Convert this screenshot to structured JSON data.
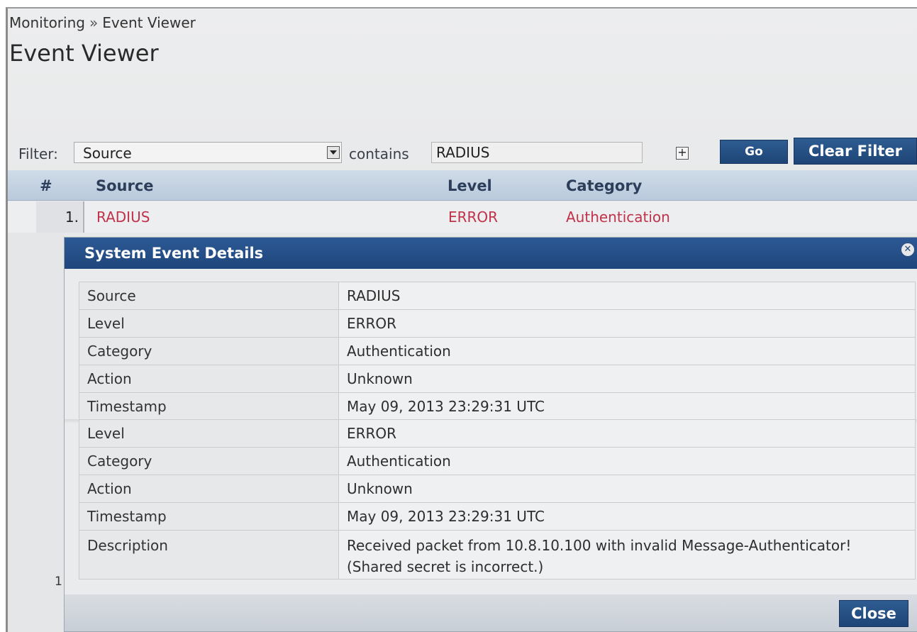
{
  "breadcrumb": {
    "parent": "Monitoring",
    "separator": "»",
    "current": "Event Viewer"
  },
  "page_title": "Event Viewer",
  "filter": {
    "label": "Filter:",
    "field_selected": "Source",
    "operator_label": "contains",
    "value": "RADIUS",
    "add_icon": "+",
    "go_label": "Go",
    "clear_label": "Clear Filter"
  },
  "grid": {
    "columns": {
      "num": "#",
      "source": "Source",
      "level": "Level",
      "category": "Category"
    },
    "rows": [
      {
        "num": "1.",
        "source": "RADIUS",
        "level": "ERROR",
        "category": "Authentication"
      }
    ],
    "page_number": "1",
    "error_color": "#c0324a"
  },
  "modal": {
    "title": "System Event Details",
    "close_icon": "close-circle-icon",
    "details_top": [
      {
        "key": "Source",
        "value": "RADIUS"
      },
      {
        "key": "Level",
        "value": "ERROR"
      },
      {
        "key": "Category",
        "value": "Authentication"
      },
      {
        "key": "Action",
        "value": "Unknown"
      },
      {
        "key": "Timestamp",
        "value": "May 09, 2013 23:29:31 UTC"
      }
    ],
    "details_bottom": [
      {
        "key": "Level",
        "value": "ERROR"
      },
      {
        "key": "Category",
        "value": "Authentication"
      },
      {
        "key": "Action",
        "value": "Unknown"
      },
      {
        "key": "Timestamp",
        "value": "May 09, 2013 23:29:31 UTC"
      },
      {
        "key": "Description",
        "value": "Received packet from 10.8.10.100 with invalid Message-Authenticator! (Shared secret is incorrect.)"
      }
    ],
    "close_label": "Close"
  },
  "colors": {
    "accent": "#1f467c",
    "header_row": "#c4d3e3"
  }
}
